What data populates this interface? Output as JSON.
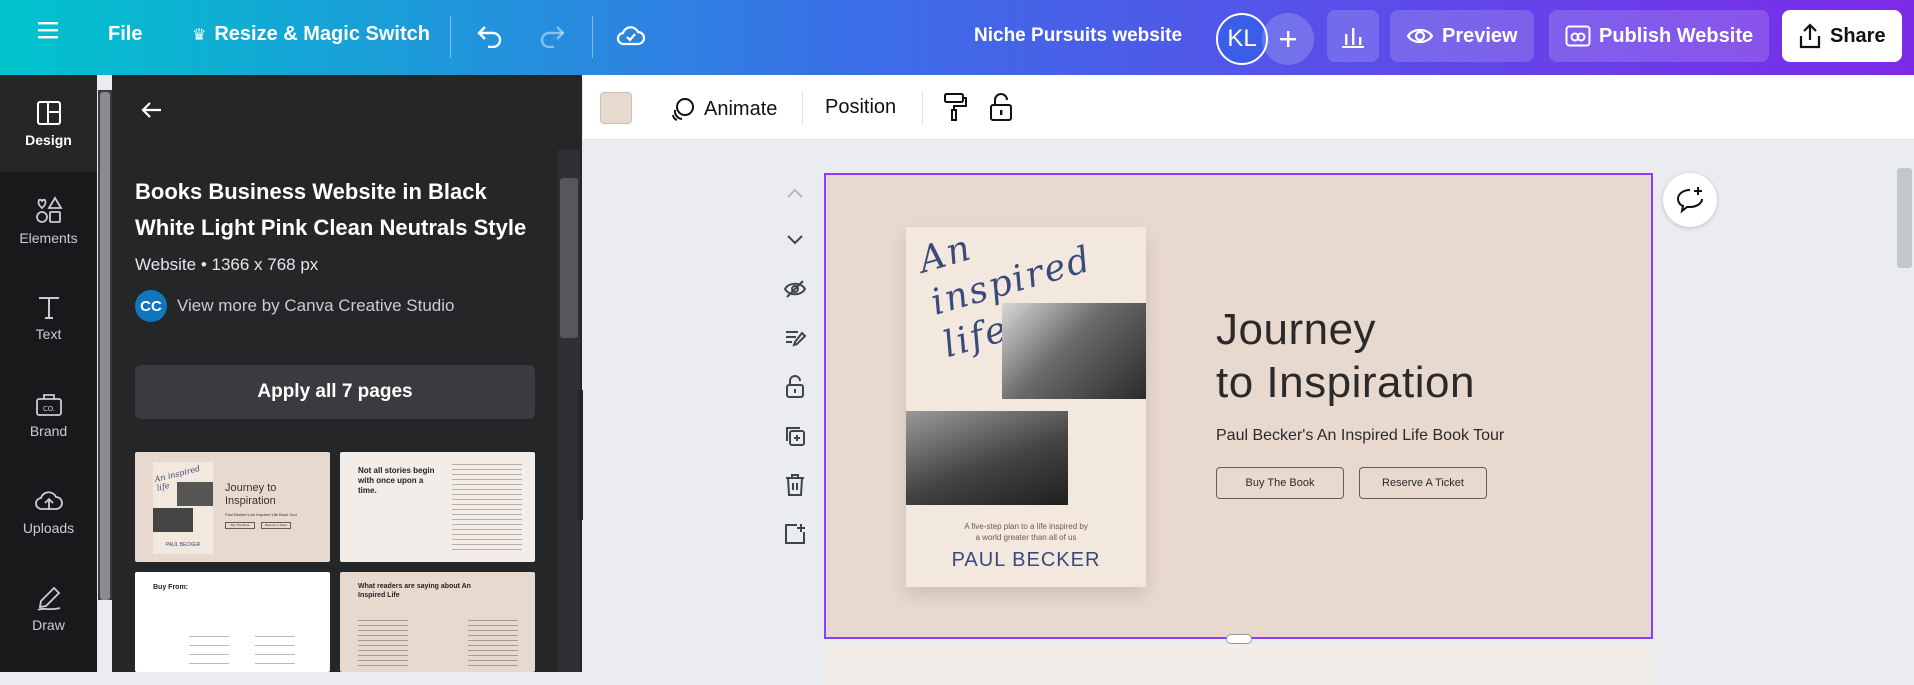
{
  "topbar": {
    "file": "File",
    "resize": "Resize & Magic Switch",
    "doc_title": "Niche Pursuits website",
    "avatar_initials": "KL",
    "preview": "Preview",
    "publish": "Publish Website",
    "share": "Share"
  },
  "rail": {
    "items": [
      {
        "label": "Design"
      },
      {
        "label": "Elements"
      },
      {
        "label": "Text"
      },
      {
        "label": "Brand"
      },
      {
        "label": "Uploads"
      },
      {
        "label": "Draw"
      }
    ]
  },
  "panel": {
    "template_title": "Books Business Website in Black White Light Pink Clean Neutrals Style",
    "template_meta": "Website • 1366 x 768 px",
    "author_badge": "CC",
    "author_link": "View more by Canva Creative Studio",
    "apply_button": "Apply all 7 pages",
    "thumbs": {
      "t1": {
        "script": "An inspired life",
        "title": "Journey to Inspiration",
        "sub": "Paul Becker's An Inspired Life Book Tour",
        "b1": "Buy The Book",
        "b2": "Reserve A Ticket",
        "author": "PAUL BECKER"
      },
      "t2": {
        "title": "Not all stories begin with once upon a time."
      },
      "t3": {
        "title": "Buy From:"
      },
      "t4": {
        "title": "What readers are saying about An Inspired Life"
      }
    }
  },
  "toolbar": {
    "animate": "Animate",
    "position": "Position",
    "swatch_color": "#e8d9cf"
  },
  "page": {
    "script": "An inspired life",
    "book_tagline_1": "A five-step plan to a life inspired by",
    "book_tagline_2": "a world greater than all of us",
    "book_author": "PAUL BECKER",
    "title_line1": "Journey",
    "title_line2": "to Inspiration",
    "subtitle": "Paul Becker's An Inspired Life Book Tour",
    "button1": "Buy The Book",
    "button2": "Reserve A Ticket"
  },
  "colors": {
    "accent": "#8b3dff",
    "page_bg": "#e8d9cf",
    "book_bg": "#f3e8de",
    "book_text": "#3a4a7a"
  }
}
